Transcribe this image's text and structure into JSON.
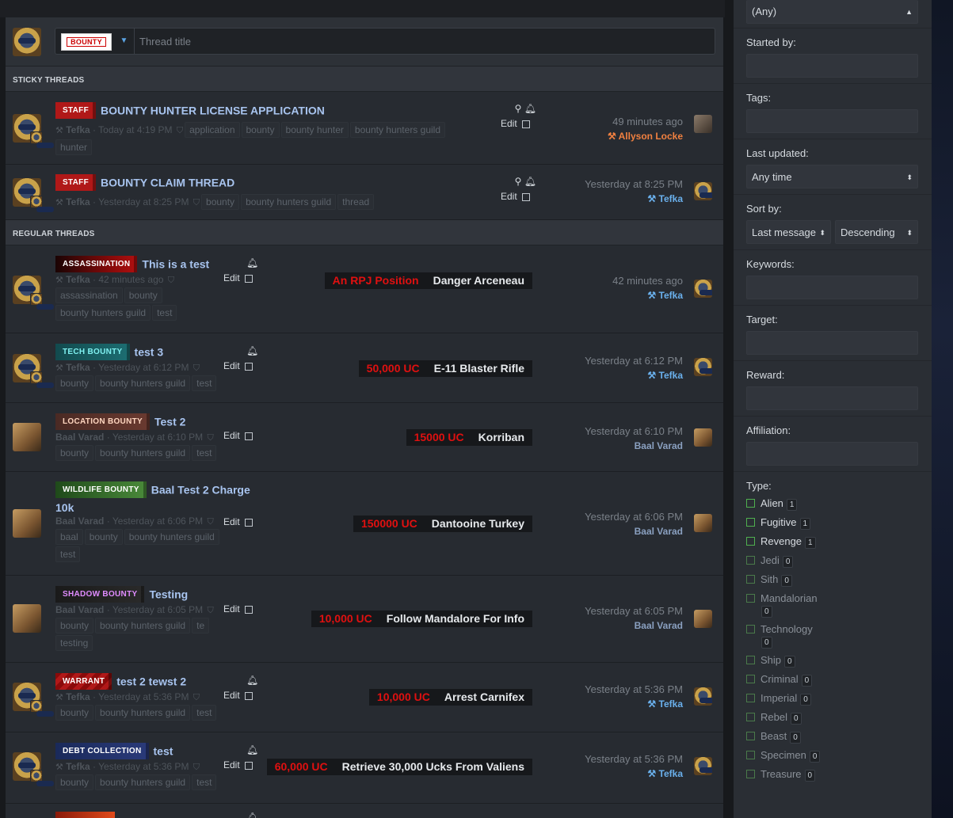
{
  "new_thread": {
    "prefix": "BOUNTY",
    "placeholder": "Thread title"
  },
  "sections": {
    "sticky": "STICKY THREADS",
    "regular": "REGULAR THREADS"
  },
  "sticky_threads": [
    {
      "prefix": "STAFF",
      "title": "BOUNTY HUNTER LICENSE APPLICATION",
      "author": "Tefka",
      "date": "Today at 4:19 PM",
      "tags": [
        "application",
        "bounty",
        "bounty hunter",
        "bounty hunters guild",
        "hunter"
      ],
      "edit": "Edit",
      "last_time": "49 minutes ago",
      "last_user": "Allyson Locke"
    },
    {
      "prefix": "STAFF",
      "title": "BOUNTY CLAIM THREAD",
      "author": "Tefka",
      "date": "Yesterday at 8:25 PM",
      "tags": [
        "bounty",
        "bounty hunters guild",
        "thread"
      ],
      "edit": "Edit",
      "last_time": "Yesterday at 8:25 PM",
      "last_user": "Tefka"
    }
  ],
  "threads": [
    {
      "prefix": "ASSASSINATION",
      "title": "This is a test",
      "author": "Tefka",
      "date": "42 minutes ago",
      "tags": [
        "assassination",
        "bounty",
        "bounty hunters guild",
        "test"
      ],
      "edit": "Edit",
      "reward": "An RPJ Position",
      "target": "Danger Arceneau",
      "last_time": "42 minutes ago",
      "last_user": "Tefka"
    },
    {
      "prefix": "TECH BOUNTY",
      "title": "test 3",
      "author": "Tefka",
      "date": "Yesterday at 6:12 PM",
      "tags": [
        "bounty",
        "bounty hunters guild",
        "test"
      ],
      "edit": "Edit",
      "reward": "50,000 UC",
      "target": "E-11 Blaster Rifle",
      "last_time": "Yesterday at 6:12 PM",
      "last_user": "Tefka"
    },
    {
      "prefix": "LOCATION BOUNTY",
      "title": "Test 2",
      "author": "Baal Varad",
      "date": "Yesterday at 6:10 PM",
      "tags": [
        "bounty",
        "bounty hunters guild",
        "test"
      ],
      "edit": "Edit",
      "reward": "15000 UC",
      "target": "Korriban",
      "last_time": "Yesterday at 6:10 PM",
      "last_user": "Baal Varad"
    },
    {
      "prefix": "WILDLIFE BOUNTY",
      "title": "Baal Test 2 Charge",
      "title2": "10k",
      "author": "Baal Varad",
      "date": "Yesterday at 6:06 PM",
      "tags": [
        "baal",
        "bounty",
        "bounty hunters guild",
        "test"
      ],
      "edit": "Edit",
      "reward": "150000 UC",
      "target": "Dantooine Turkey",
      "last_time": "Yesterday at 6:06 PM",
      "last_user": "Baal Varad"
    },
    {
      "prefix": "SHADOW BOUNTY",
      "title": "Testing",
      "author": "Baal Varad",
      "date": "Yesterday at 6:05 PM",
      "tags": [
        "bounty",
        "bounty hunters guild",
        "te",
        "testing"
      ],
      "edit": "Edit",
      "reward": "10,000 UC",
      "target": "Follow Mandalore For Info",
      "last_time": "Yesterday at 6:05 PM",
      "last_user": "Baal Varad"
    },
    {
      "prefix": "WARRANT",
      "title": "test 2 tewst 2",
      "author": "Tefka",
      "date": "Yesterday at 5:36 PM",
      "tags": [
        "bounty",
        "bounty hunters guild",
        "test"
      ],
      "edit": "Edit",
      "reward": "10,000 UC",
      "target": "Arrest Carnifex",
      "last_time": "Yesterday at 5:36 PM",
      "last_user": "Tefka"
    },
    {
      "prefix": "DEBT COLLECTION",
      "title": "test",
      "author": "Tefka",
      "date": "Yesterday at 5:36 PM",
      "tags": [
        "bounty",
        "bounty hunters guild",
        "test"
      ],
      "edit": "Edit",
      "reward": "60,000 UC",
      "target": "Retrieve 30,000 Ucks From Valiens",
      "last_time": "Yesterday at 5:36 PM",
      "last_user": "Tefka"
    }
  ],
  "filters": {
    "prefix_value": "(Any)",
    "started_by": "Started by:",
    "tags": "Tags:",
    "last_updated": "Last updated:",
    "last_updated_value": "Any time",
    "sort_by": "Sort by:",
    "sort_field": "Last message",
    "sort_dir": "Descending",
    "keywords": "Keywords:",
    "target": "Target:",
    "reward": "Reward:",
    "affiliation": "Affiliation:",
    "type": "Type:",
    "types": [
      {
        "label": "Alien",
        "count": "1"
      },
      {
        "label": "Fugitive",
        "count": "1"
      },
      {
        "label": "Revenge",
        "count": "1"
      },
      {
        "label": "Jedi",
        "count": "0"
      },
      {
        "label": "Sith",
        "count": "0"
      },
      {
        "label": "Mandalorian",
        "count": "0"
      },
      {
        "label": "Technology",
        "count": "0"
      },
      {
        "label": "Ship",
        "count": "0"
      },
      {
        "label": "Criminal",
        "count": "0"
      },
      {
        "label": "Imperial",
        "count": "0"
      },
      {
        "label": "Rebel",
        "count": "0"
      },
      {
        "label": "Beast",
        "count": "0"
      },
      {
        "label": "Specimen",
        "count": "0"
      },
      {
        "label": "Treasure",
        "count": "0"
      }
    ]
  }
}
